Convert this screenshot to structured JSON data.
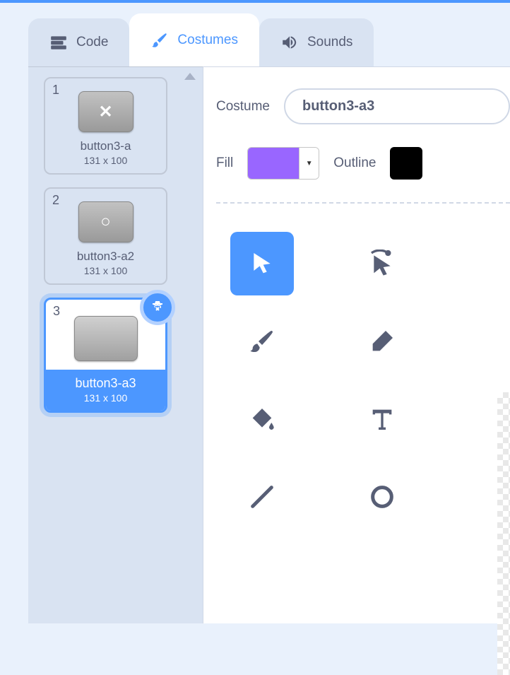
{
  "tabs": {
    "code": "Code",
    "costumes": "Costumes",
    "sounds": "Sounds"
  },
  "sidebar": {
    "costumes": [
      {
        "num": "1",
        "name": "button3-a",
        "dims": "131 x 100",
        "glyph": "✕",
        "selected": false
      },
      {
        "num": "2",
        "name": "button3-a2",
        "dims": "131 x 100",
        "glyph": "○",
        "selected": false
      },
      {
        "num": "3",
        "name": "button3-a3",
        "dims": "131 x 100",
        "glyph": "",
        "selected": true
      }
    ]
  },
  "editor": {
    "costume_label": "Costume",
    "costume_name": "button3-a3",
    "fill_label": "Fill",
    "fill_color": "#9966ff",
    "outline_label": "Outline",
    "outline_color": "#000000"
  },
  "tools": {
    "select": "select-tool",
    "reshape": "reshape-tool",
    "brush": "brush-tool",
    "eraser": "eraser-tool",
    "fill": "fill-tool",
    "text": "text-tool",
    "line": "line-tool",
    "circle": "circle-tool"
  }
}
